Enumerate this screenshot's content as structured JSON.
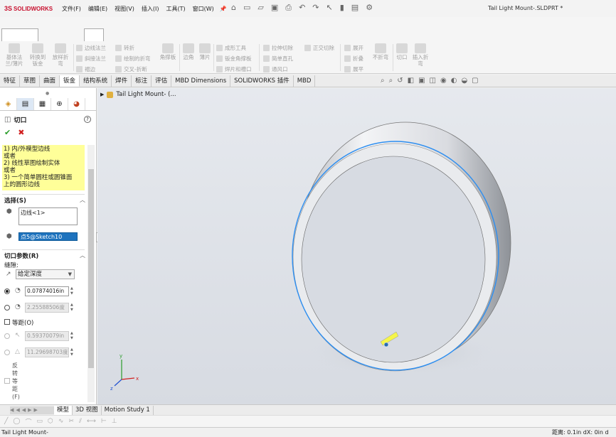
{
  "app": {
    "logo_ds": "3S",
    "logo_name": "SOLIDWORKS",
    "document_title": "Tail Light Mount-.SLDPRT *"
  },
  "menu": [
    "文件(F)",
    "编辑(E)",
    "视图(V)",
    "插入(I)",
    "工具(T)",
    "窗口(W)"
  ],
  "ribbon": {
    "large_buttons": [
      "基体法兰/薄片",
      "转换到钣金",
      "放样折弯",
      "边线法兰",
      "斜接法兰",
      "褶边",
      "转折",
      "绘制的折弯",
      "交叉-折断",
      "拉伸切除",
      "简单直孔",
      "通风口",
      "展开",
      "折叠",
      "展平",
      "不折弯",
      "切口",
      "插入折弯"
    ],
    "labels": {
      "b1": "基体法\n兰/薄片",
      "b2": "转换到\n钣金",
      "b3": "放样折\n弯",
      "s1": "边线法兰",
      "s2": "斜接法兰",
      "s3": "褶边",
      "s4": "转折",
      "s5": "绘制的折弯",
      "s6": "交叉-折断",
      "b4": "角撑板",
      "b5": "边角",
      "b6": "薄片",
      "s7": "成形工具",
      "s8": "钣金角撑板",
      "s9": "焊片和槽口",
      "s10": "拉伸切除",
      "s11": "简单直孔",
      "s12": "通风口",
      "s13": "正交切除",
      "s14": "展开",
      "s15": "折叠",
      "s16": "展平",
      "b7": "不折弯",
      "b8": "切口",
      "b9": "插入折\n弯"
    }
  },
  "tabs": [
    "特征",
    "草图",
    "曲面",
    "钣金",
    "结构系统",
    "焊件",
    "标注",
    "评估",
    "MBD Dimensions",
    "SOLIDWORKS 插件",
    "MBD"
  ],
  "active_tab": "钣金",
  "tree": {
    "root_label": "Tail Light Mount- (..."
  },
  "property_manager": {
    "title": "切口",
    "help": "?",
    "message": "1) 内/外模型边线\n或者\n2) 线性草图绘制实体\n或者\n3) 一个简单圆柱或圆锥面\n上的圆形边线",
    "selection_section": "选择(S)",
    "edge_list": "边线<1>",
    "point_field": "点5@Sketch10",
    "cut_params_section": "切口参数(R)",
    "gap_label": "缝隙:",
    "end_condition": "给定深度",
    "gap_value": "0.07874016in",
    "angle_value": "2.25588506度",
    "equal_distance_label": "等距(O)",
    "offset_value": "0.59370079in",
    "offset_angle_value": "11.29698703度",
    "reverse_label": "反\n转\n等\n距\n(F)"
  },
  "bottom_tabs": [
    "模型",
    "3D 视图",
    "Motion Study 1"
  ],
  "active_bottom_tab": "模型",
  "status": {
    "left": "Tail Light Mount-",
    "right": "距离: 0.1in  dX: 0in  d"
  },
  "triad": {
    "x": "x",
    "y": "y",
    "z": "z"
  },
  "colors": {
    "accent": "#1e73be",
    "message_bg": "#ffff99",
    "selection_edge": "#2d8ef0",
    "brand": "#c8102e"
  }
}
